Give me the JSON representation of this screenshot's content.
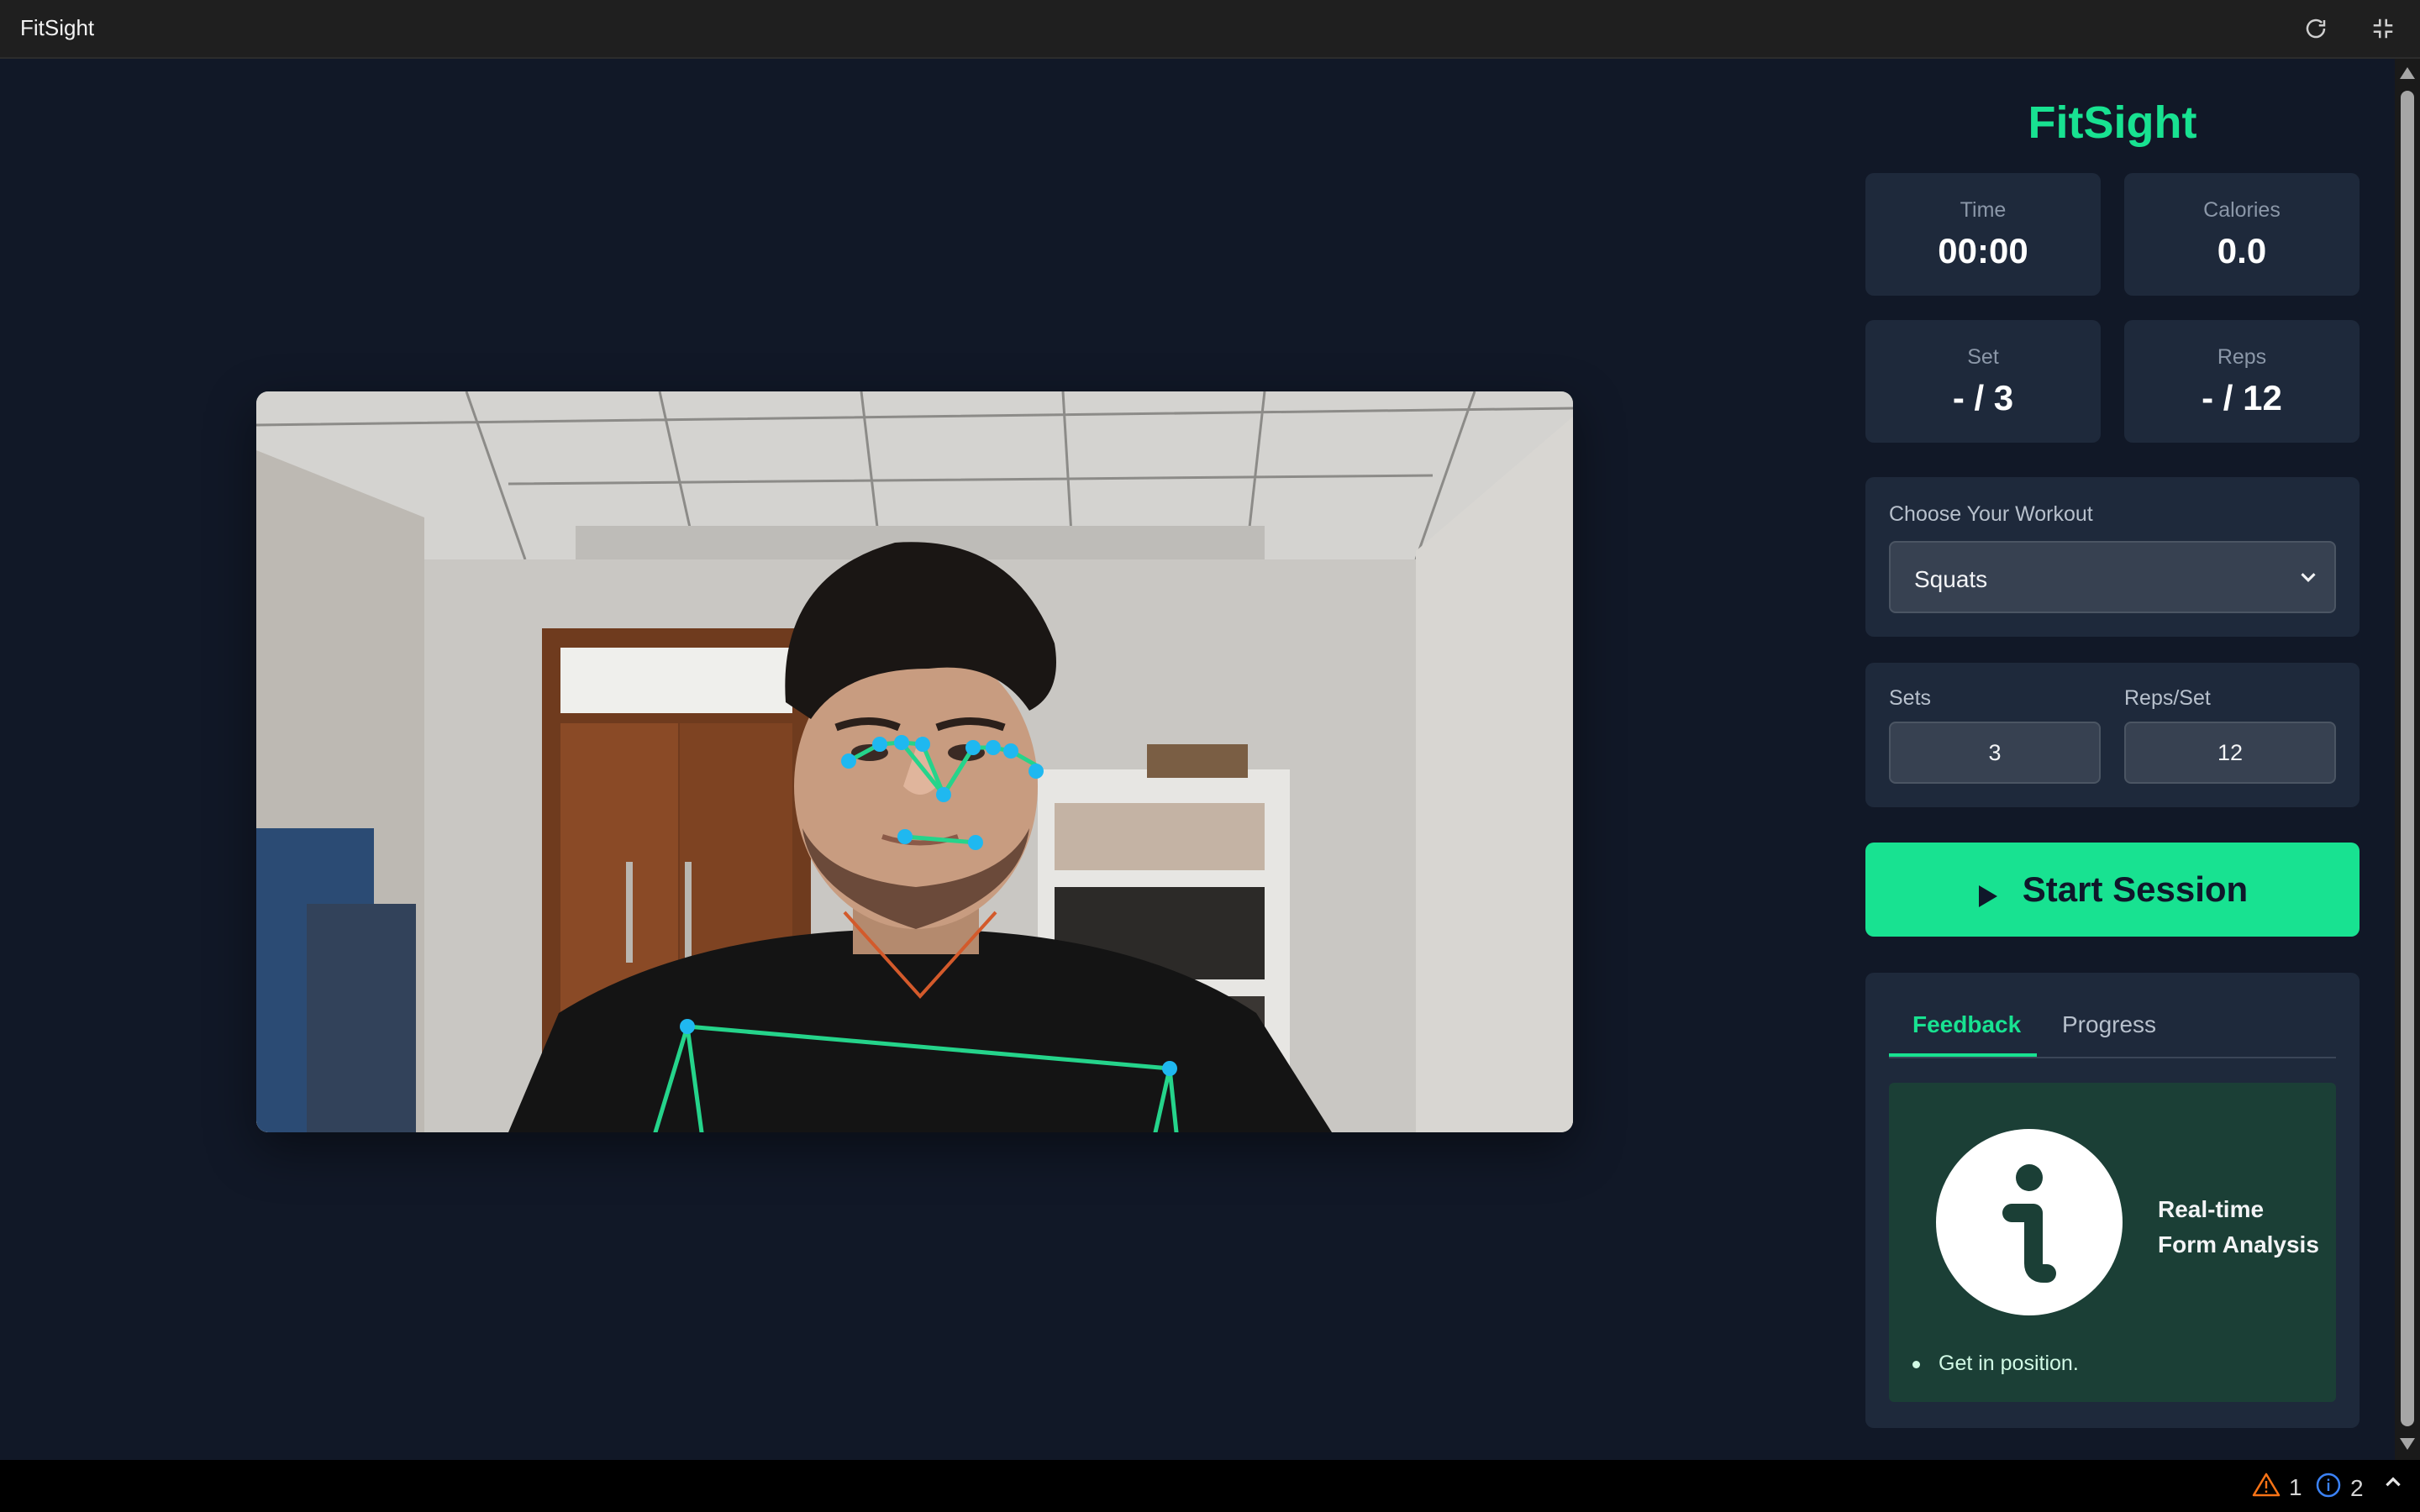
{
  "window": {
    "title": "FitSight"
  },
  "sidebar": {
    "brand": "FitSight",
    "stats": {
      "time": {
        "label": "Time",
        "value": "00:00"
      },
      "calories": {
        "label": "Calories",
        "value": "0.0"
      },
      "set": {
        "label": "Set",
        "value": "- / 3"
      },
      "reps": {
        "label": "Reps",
        "value": "- / 12"
      }
    },
    "workout": {
      "label": "Choose Your Workout",
      "selected": "Squats"
    },
    "config": {
      "sets_label": "Sets",
      "sets_value": "3",
      "reps_label": "Reps/Set",
      "reps_value": "12"
    },
    "start_button": "Start Session",
    "tabs": [
      {
        "label": "Feedback"
      },
      {
        "label": "Progress"
      }
    ],
    "feedback": {
      "title_line1": "Real-time",
      "title_line2": "Form Analysis",
      "items": [
        "Get in position."
      ]
    }
  },
  "statusbar": {
    "warnings": "1",
    "infos": "2"
  },
  "colors": {
    "accent": "#18e291",
    "background": "#111827",
    "card": "#1e293b",
    "landmark": "#1fb8f0"
  },
  "icons": [
    "refresh-icon",
    "exit-fullscreen-icon",
    "chevron-down-icon",
    "play-icon",
    "info-icon",
    "warning-icon",
    "info-circle-icon",
    "chevron-up-icon"
  ]
}
